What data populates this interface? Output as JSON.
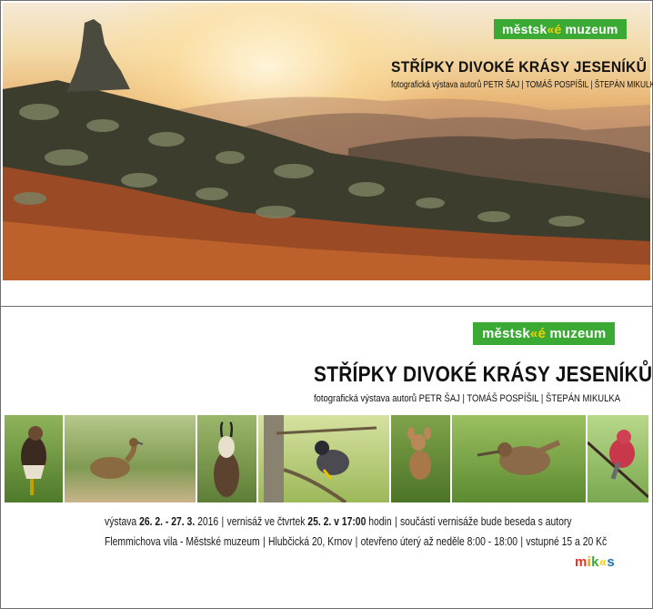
{
  "museum_logo": {
    "text_before": "městsk",
    "text_mark": "«é",
    "text_after": " muzeum"
  },
  "exhibition": {
    "title": "STŘÍPKY DIVOKÉ KRÁSY JESENÍKŮ",
    "subtitle": "fotografická výstava autorů  PETR ŠAJ  |  TOMÁŠ POSPÍŠIL  |  ŠTEPÁN MIKULKA",
    "subtitle_bottom": "fotografická výstava autorů  PETR ŠAJ  |  TOMÁŠ POSPÍŠIL  |  ŠTEPÁN MIKULKA"
  },
  "details": {
    "line1": {
      "a": "výstava ",
      "dates": "26. 2. - 27. 3.",
      "year": " 2016",
      "b": "vernisáž ve čtvrtek ",
      "vernissage": "25. 2. v 17:00",
      "c": " hodin",
      "d": "součástí vernisáže bude beseda s autory"
    },
    "line2": {
      "venue": "Flemmichova vila - Městské muzeum",
      "address": "Hlubčická 20, Krnov",
      "hours": "otevřeno úterý až neděle 8:00 - 18:00",
      "fee": "vstupné 15 a 20 Kč"
    },
    "separator": "|"
  },
  "partner_logo": {
    "m": "m",
    "i": "i",
    "k": "k",
    "o": "«",
    "s": "s"
  },
  "photos": [
    "bird-of-prey",
    "corncrake",
    "chamois",
    "peregrine-falcon",
    "fawn",
    "woodcock",
    "rosefinch"
  ]
}
